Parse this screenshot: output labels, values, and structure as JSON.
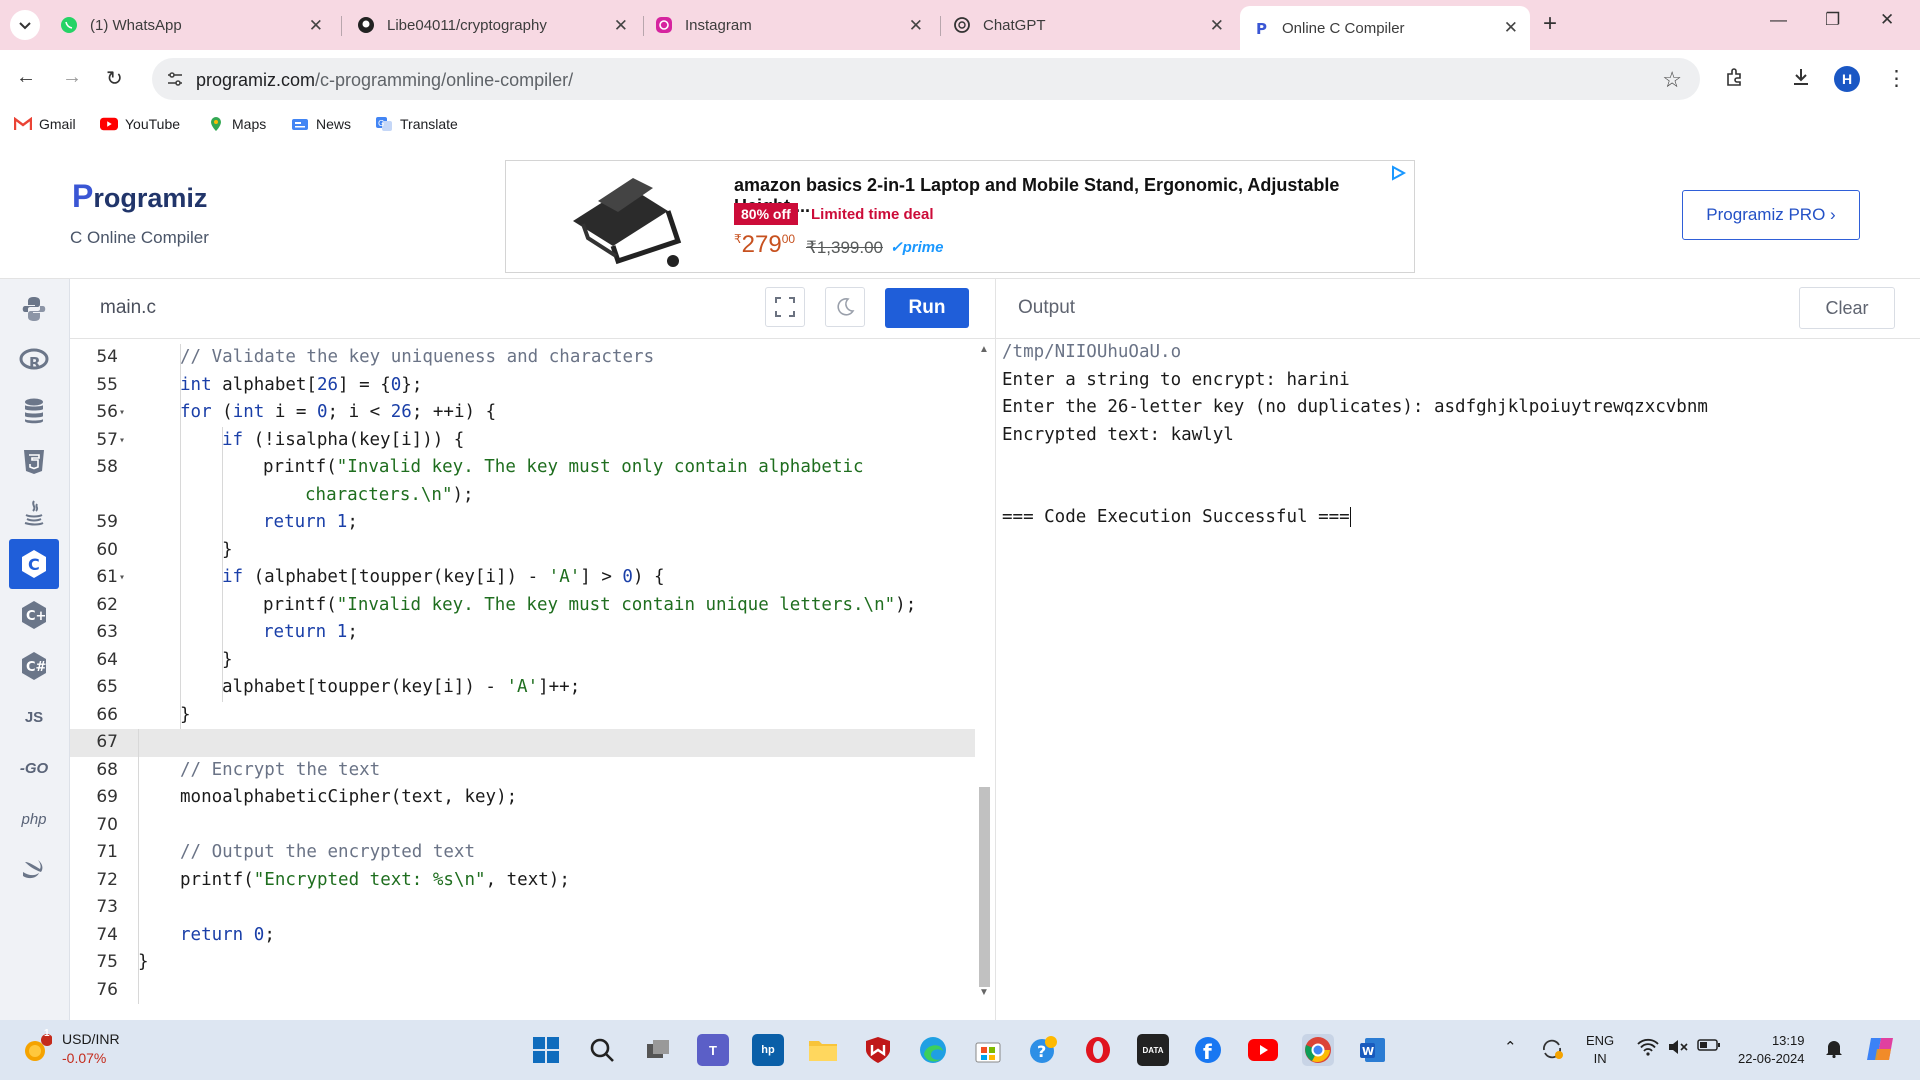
{
  "browser": {
    "tabs": [
      {
        "title": "(1) WhatsApp",
        "icon": "whatsapp-icon"
      },
      {
        "title": "Libe04011/cryptography",
        "icon": "github-icon"
      },
      {
        "title": "Instagram",
        "icon": "instagram-icon"
      },
      {
        "title": "ChatGPT",
        "icon": "chatgpt-icon"
      },
      {
        "title": "Online C Compiler",
        "icon": "programiz-icon",
        "active": true
      }
    ],
    "url_host": "programiz.com",
    "url_path": "/c-programming/online-compiler/",
    "profile_initial": "H",
    "bookmarks": [
      {
        "label": "Gmail",
        "icon": "gmail-icon"
      },
      {
        "label": "YouTube",
        "icon": "youtube-icon"
      },
      {
        "label": "Maps",
        "icon": "maps-icon"
      },
      {
        "label": "News",
        "icon": "news-icon"
      },
      {
        "label": "Translate",
        "icon": "translate-icon"
      }
    ]
  },
  "site": {
    "logo": "rogramiz",
    "logo_initial": "P",
    "subtitle": "C Online Compiler",
    "pro_button": "Programiz PRO ›",
    "ad": {
      "title": "amazon basics 2-in-1 Laptop and Mobile Stand, Ergonomic, Adjustable Height,...",
      "badge": "80% off",
      "deal": "Limited time deal",
      "price_symbol": "₹",
      "price": "279",
      "price_fraction": "00",
      "old_price": "₹1,399.00",
      "prime": "✓prime"
    }
  },
  "rail": {
    "items": [
      "python-icon",
      "r-icon",
      "sql-icon",
      "html-icon",
      "java-icon",
      "c-icon",
      "cpp-icon",
      "csharp-icon",
      "js-icon",
      "go-icon",
      "php-icon",
      "swift-icon"
    ],
    "labels": {
      "js": "JS",
      "go": "-GO",
      "php": "php"
    },
    "active": "c-icon"
  },
  "editor": {
    "filename": "main.c",
    "run_label": "Run"
  },
  "output": {
    "title": "Output",
    "clear_label": "Clear",
    "lines": [
      "/tmp/NIIOUhuOaU.o",
      "Enter a string to encrypt: harini",
      "Enter the 26-letter key (no duplicates): asdfghjklpoiuytrewqzxcvbnm",
      "Encrypted text: kawlyl",
      "",
      "",
      "=== Code Execution Successful ==="
    ]
  },
  "taskbar": {
    "ticker": "USD/INR",
    "change": "-0.07%",
    "notification_count": "1",
    "lang_top": "ENG",
    "lang_bottom": "IN",
    "time": "13:19",
    "date": "22-06-2024"
  }
}
